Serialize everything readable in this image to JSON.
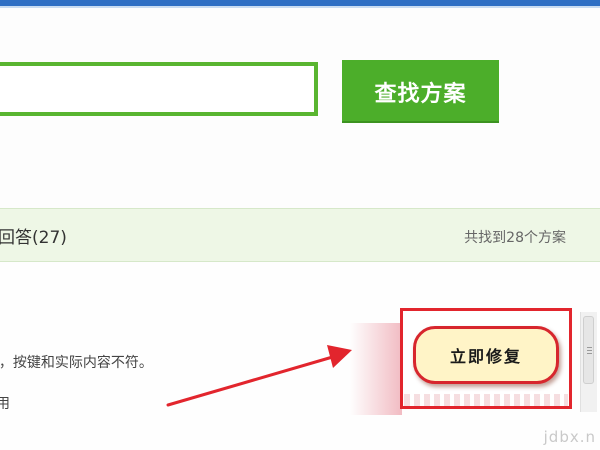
{
  "search": {
    "input_value": "",
    "button_label": "查找方案"
  },
  "results": {
    "answers_label": "回答(27)",
    "found_label": "共找到28个方案"
  },
  "result_item": {
    "line1": "f，按键和实际内容不符。",
    "line2": "用"
  },
  "annotation": {
    "fix_button_label": "立即修复",
    "box_color": "#e2252d",
    "arrow_color": "#e2252d"
  },
  "icons": {
    "arrow": "red-arrow-icon"
  },
  "watermark": "jdbx.n",
  "colors": {
    "accent_green": "#4cae2a",
    "results_bar_bg": "#eef7e6",
    "header_blue": "#2f6fc4"
  }
}
